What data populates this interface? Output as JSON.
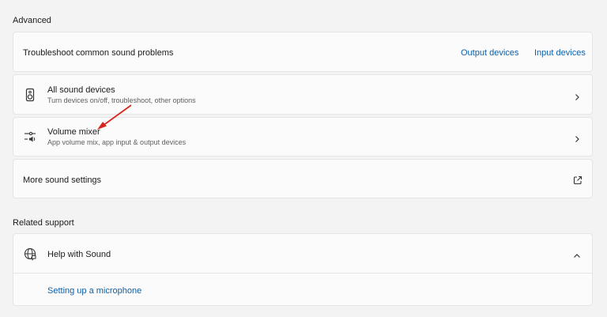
{
  "advanced": {
    "title": "Advanced",
    "troubleshoot": {
      "label": "Troubleshoot common sound problems",
      "output_link": "Output devices",
      "input_link": "Input devices"
    },
    "all_devices": {
      "title": "All sound devices",
      "subtitle": "Turn devices on/off, troubleshoot, other options"
    },
    "volume_mixer": {
      "title": "Volume mixer",
      "subtitle": "App volume mix, app input & output devices"
    },
    "more_settings": {
      "label": "More sound settings"
    }
  },
  "related": {
    "title": "Related support",
    "help": {
      "title": "Help with Sound",
      "link": "Setting up a microphone"
    }
  },
  "icons": {
    "speaker": "speaker-icon",
    "mixer": "mixer-icon",
    "external": "external-link-icon",
    "globe": "globe-icon",
    "chevron_right": "chevron-right-icon",
    "chevron_up": "chevron-up-icon"
  },
  "colors": {
    "accent": "#0f5fa8",
    "annotation_arrow": "#d4261f"
  }
}
